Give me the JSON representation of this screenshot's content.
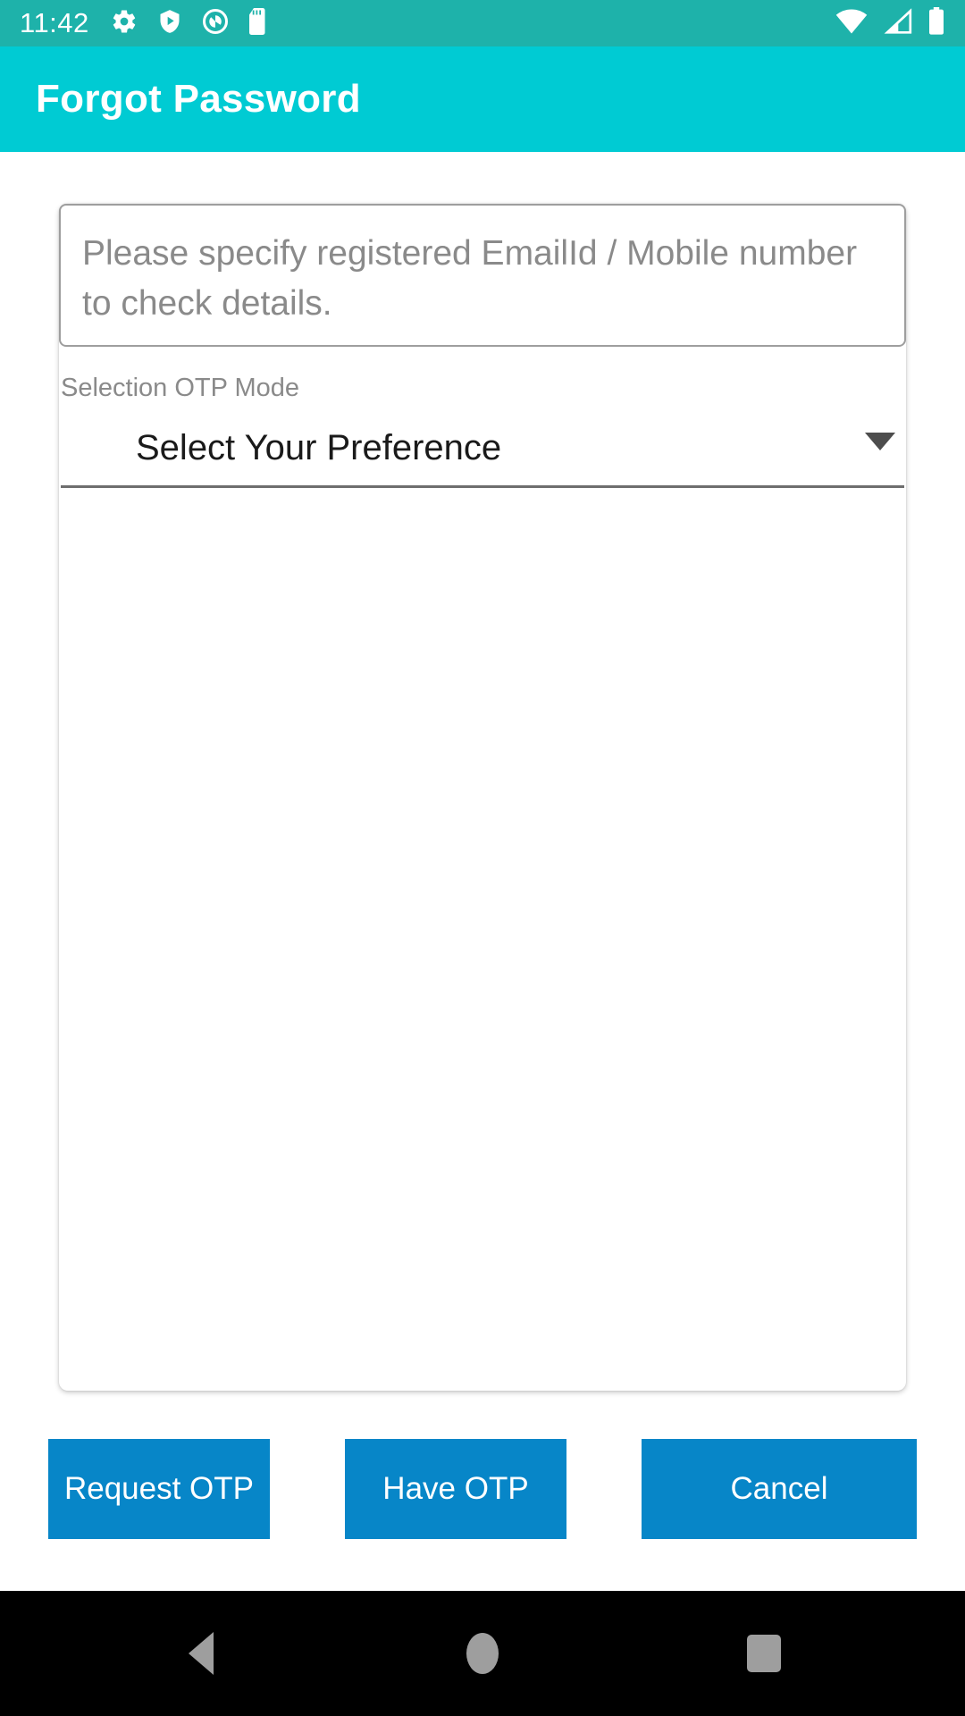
{
  "status_bar": {
    "time": "11:42",
    "background_color": "#1eb2aa",
    "left_icons": [
      {
        "name": "gear-icon",
        "label": "settings"
      },
      {
        "name": "shield-play-icon",
        "label": "protected-media"
      },
      {
        "name": "circle-logo-icon",
        "label": "app-badge"
      },
      {
        "name": "sd-card-icon",
        "label": "sd-card"
      }
    ],
    "right_icons": [
      {
        "name": "wifi-icon",
        "label": "wifi-full"
      },
      {
        "name": "cellular-signal-icon",
        "label": "signal"
      },
      {
        "name": "battery-icon",
        "label": "battery-full"
      }
    ]
  },
  "toolbar": {
    "title": "Forgot Password",
    "background_color": "#00cbd3",
    "title_color": "#ffffff"
  },
  "form": {
    "identifier_input": {
      "value": "",
      "placeholder": "Please specify registered EmailId / Mobile number to check details."
    },
    "otp_mode": {
      "label": "Selection OTP Mode",
      "selected": "Select Your Preference",
      "arrow_icon": "chevron-down-icon"
    }
  },
  "buttons": {
    "request_otp": "Request OTP",
    "have_otp": "Have OTP",
    "cancel": "Cancel",
    "color": "#0786c8",
    "text_color": "#ffffff"
  },
  "nav_bar": {
    "background_color": "#000000",
    "back": "back-icon",
    "home": "home-icon",
    "recents": "recents-icon"
  }
}
